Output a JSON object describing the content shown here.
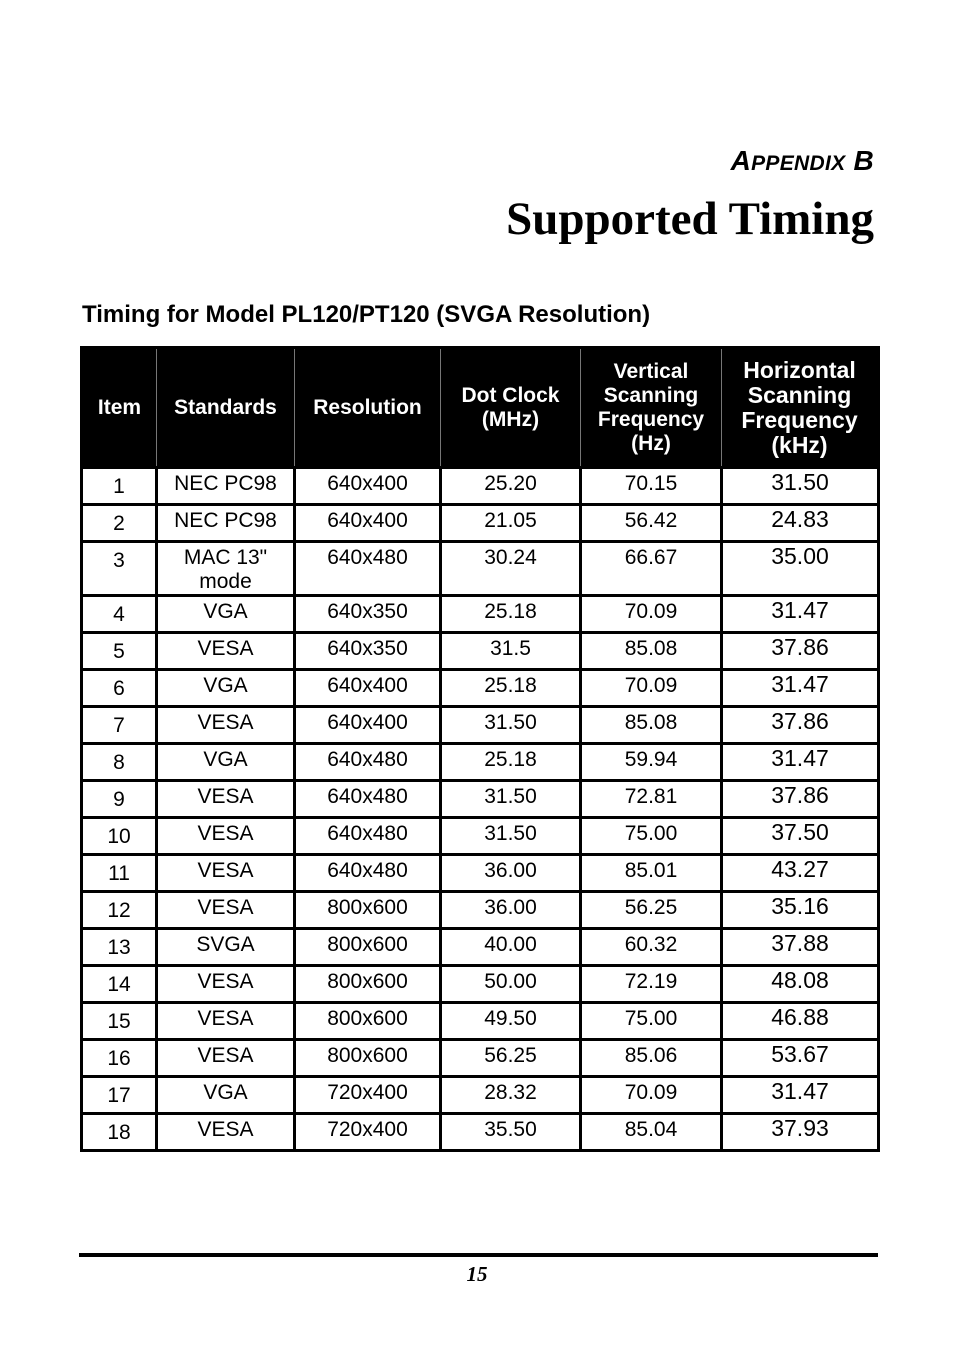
{
  "header": {
    "appendix_first": "A",
    "appendix_rest": "PPENDIX",
    "appendix_letter": " B",
    "title": "Supported Timing"
  },
  "section": {
    "subtitle": "Timing for Model PL120/PT120 (SVGA Resolution)"
  },
  "table": {
    "headers": {
      "item": "Item",
      "standards": "Standards",
      "resolution": "Resolution",
      "dot_clock_l1": "Dot Clock",
      "dot_clock_l2": "(MHz)",
      "vfreq_l1": "Vertical",
      "vfreq_l2": "Scanning",
      "vfreq_l3": "Frequency",
      "vfreq_l4": "(Hz)",
      "hfreq_l1": "Horizontal",
      "hfreq_l2": "Scanning",
      "hfreq_l3": "Frequency",
      "hfreq_l4": "(kHz)"
    },
    "rows": [
      {
        "item": "1",
        "standard": "NEC PC98",
        "standard_l2": "",
        "resolution": "640x400",
        "dot_clock": "25.20",
        "vfreq": "70.15",
        "hfreq": "31.50"
      },
      {
        "item": "2",
        "standard": "NEC PC98",
        "standard_l2": "",
        "resolution": "640x400",
        "dot_clock": "21.05",
        "vfreq": "56.42",
        "hfreq": "24.83"
      },
      {
        "item": "3",
        "standard": "MAC 13\"",
        "standard_l2": "mode",
        "resolution": "640x480",
        "dot_clock": "30.24",
        "vfreq": "66.67",
        "hfreq": "35.00"
      },
      {
        "item": "4",
        "standard": "VGA",
        "standard_l2": "",
        "resolution": "640x350",
        "dot_clock": "25.18",
        "vfreq": "70.09",
        "hfreq": "31.47"
      },
      {
        "item": "5",
        "standard": "VESA",
        "standard_l2": "",
        "resolution": "640x350",
        "dot_clock": "31.5",
        "vfreq": "85.08",
        "hfreq": "37.86"
      },
      {
        "item": "6",
        "standard": "VGA",
        "standard_l2": "",
        "resolution": "640x400",
        "dot_clock": "25.18",
        "vfreq": "70.09",
        "hfreq": "31.47"
      },
      {
        "item": "7",
        "standard": "VESA",
        "standard_l2": "",
        "resolution": "640x400",
        "dot_clock": "31.50",
        "vfreq": "85.08",
        "hfreq": "37.86"
      },
      {
        "item": "8",
        "standard": "VGA",
        "standard_l2": "",
        "resolution": "640x480",
        "dot_clock": "25.18",
        "vfreq": "59.94",
        "hfreq": "31.47"
      },
      {
        "item": "9",
        "standard": "VESA",
        "standard_l2": "",
        "resolution": "640x480",
        "dot_clock": "31.50",
        "vfreq": "72.81",
        "hfreq": "37.86"
      },
      {
        "item": "10",
        "standard": "VESA",
        "standard_l2": "",
        "resolution": "640x480",
        "dot_clock": "31.50",
        "vfreq": "75.00",
        "hfreq": "37.50"
      },
      {
        "item": "11",
        "standard": "VESA",
        "standard_l2": "",
        "resolution": "640x480",
        "dot_clock": "36.00",
        "vfreq": "85.01",
        "hfreq": "43.27"
      },
      {
        "item": "12",
        "standard": "VESA",
        "standard_l2": "",
        "resolution": "800x600",
        "dot_clock": "36.00",
        "vfreq": "56.25",
        "hfreq": "35.16"
      },
      {
        "item": "13",
        "standard": "SVGA",
        "standard_l2": "",
        "resolution": "800x600",
        "dot_clock": "40.00",
        "vfreq": "60.32",
        "hfreq": "37.88"
      },
      {
        "item": "14",
        "standard": "VESA",
        "standard_l2": "",
        "resolution": "800x600",
        "dot_clock": "50.00",
        "vfreq": "72.19",
        "hfreq": "48.08"
      },
      {
        "item": "15",
        "standard": "VESA",
        "standard_l2": "",
        "resolution": "800x600",
        "dot_clock": "49.50",
        "vfreq": "75.00",
        "hfreq": "46.88"
      },
      {
        "item": "16",
        "standard": "VESA",
        "standard_l2": "",
        "resolution": "800x600",
        "dot_clock": "56.25",
        "vfreq": "85.06",
        "hfreq": "53.67"
      },
      {
        "item": "17",
        "standard": "VGA",
        "standard_l2": "",
        "resolution": "720x400",
        "dot_clock": "28.32",
        "vfreq": "70.09",
        "hfreq": "31.47"
      },
      {
        "item": "18",
        "standard": "VESA",
        "standard_l2": "",
        "resolution": "720x400",
        "dot_clock": "35.50",
        "vfreq": "85.04",
        "hfreq": "37.93"
      }
    ]
  },
  "footer": {
    "page_number": "15"
  }
}
